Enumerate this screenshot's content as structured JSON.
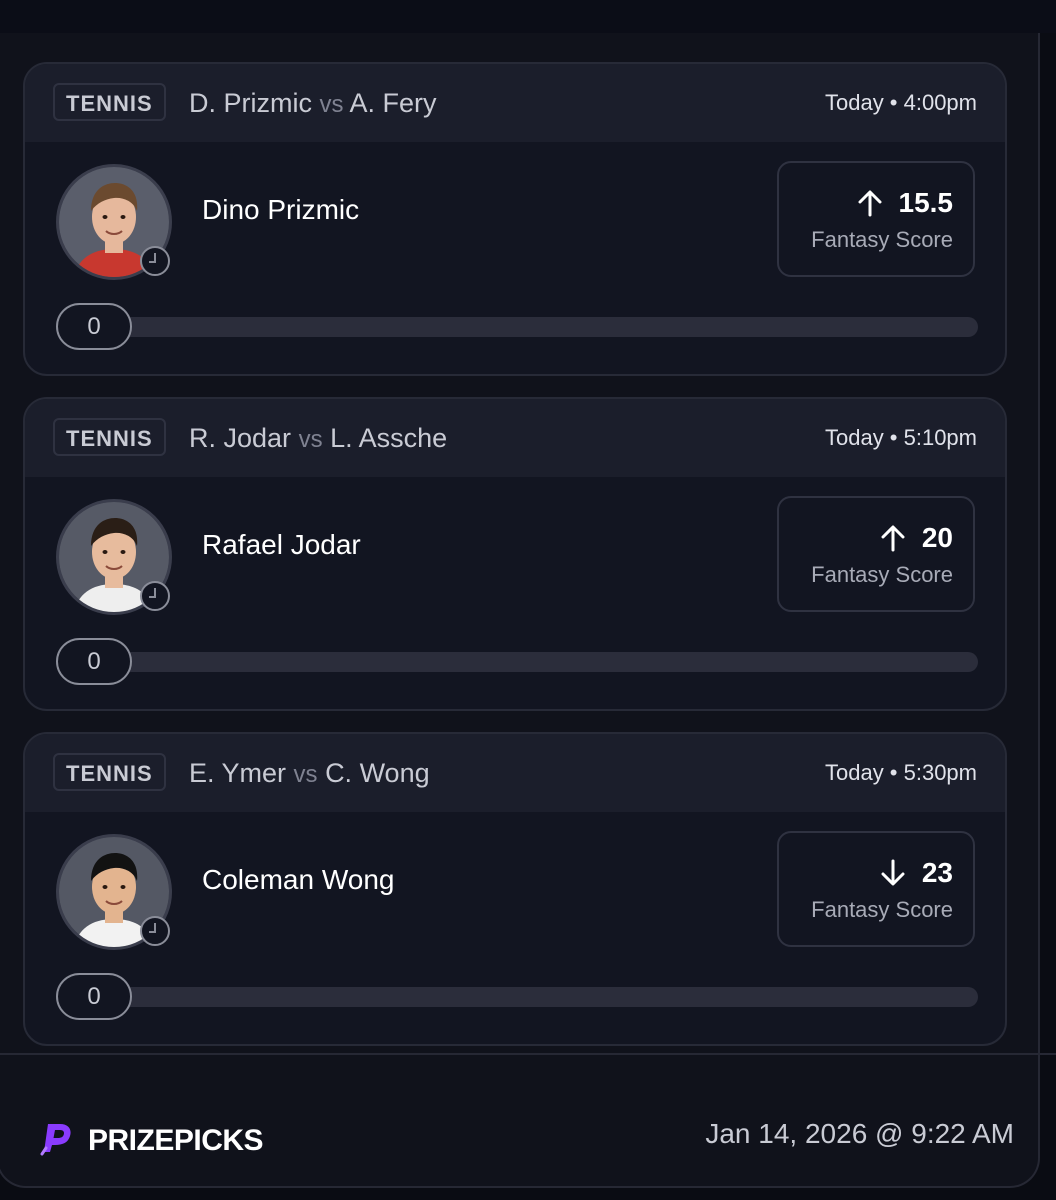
{
  "picks": [
    {
      "sport": "TENNIS",
      "team_a": "D. Prizmic",
      "vs": "vs",
      "team_b": "A. Fery",
      "time": "Today • 4:00pm",
      "player": "Dino Prizmic",
      "direction_icon": "arrow-up-icon",
      "line": "15.5",
      "stat": "Fantasy Score",
      "progress_value": "0",
      "progress_fraction": 0,
      "avatar": {
        "skin": "#e6b89c",
        "hair": "#6b4a2f",
        "shirt": "#c8382f",
        "bg": "#5a5e6b"
      }
    },
    {
      "sport": "TENNIS",
      "team_a": "R. Jodar",
      "vs": "vs",
      "team_b": "L. Assche",
      "time": "Today • 5:10pm",
      "player": "Rafael Jodar",
      "direction_icon": "arrow-up-icon",
      "line": "20",
      "stat": "Fantasy Score",
      "progress_value": "0",
      "progress_fraction": 0,
      "avatar": {
        "skin": "#e7bb9d",
        "hair": "#2a1e16",
        "shirt": "#eeeeee",
        "bg": "#565a66"
      }
    },
    {
      "sport": "TENNIS",
      "team_a": "E. Ymer",
      "vs": "vs",
      "team_b": "C. Wong",
      "time": "Today • 5:30pm",
      "player": "Coleman Wong",
      "direction_icon": "arrow-down-icon",
      "line": "23",
      "stat": "Fantasy Score",
      "progress_value": "0",
      "progress_fraction": 0,
      "avatar": {
        "skin": "#e3b48f",
        "hair": "#121212",
        "shirt": "#f2f2f2",
        "bg": "#545864"
      }
    }
  ],
  "footer": {
    "brand": "PRIZEPICKS",
    "brand_icon": "prizepicks-logo-icon",
    "timestamp": "Jan 14, 2026 @ 9:22 AM"
  },
  "colors": {
    "background": "#10121b",
    "card": "#121521",
    "card_header": "#1b1e2b",
    "brand_purple": "#8a3bff",
    "progress_fill": "#6b53ff"
  }
}
